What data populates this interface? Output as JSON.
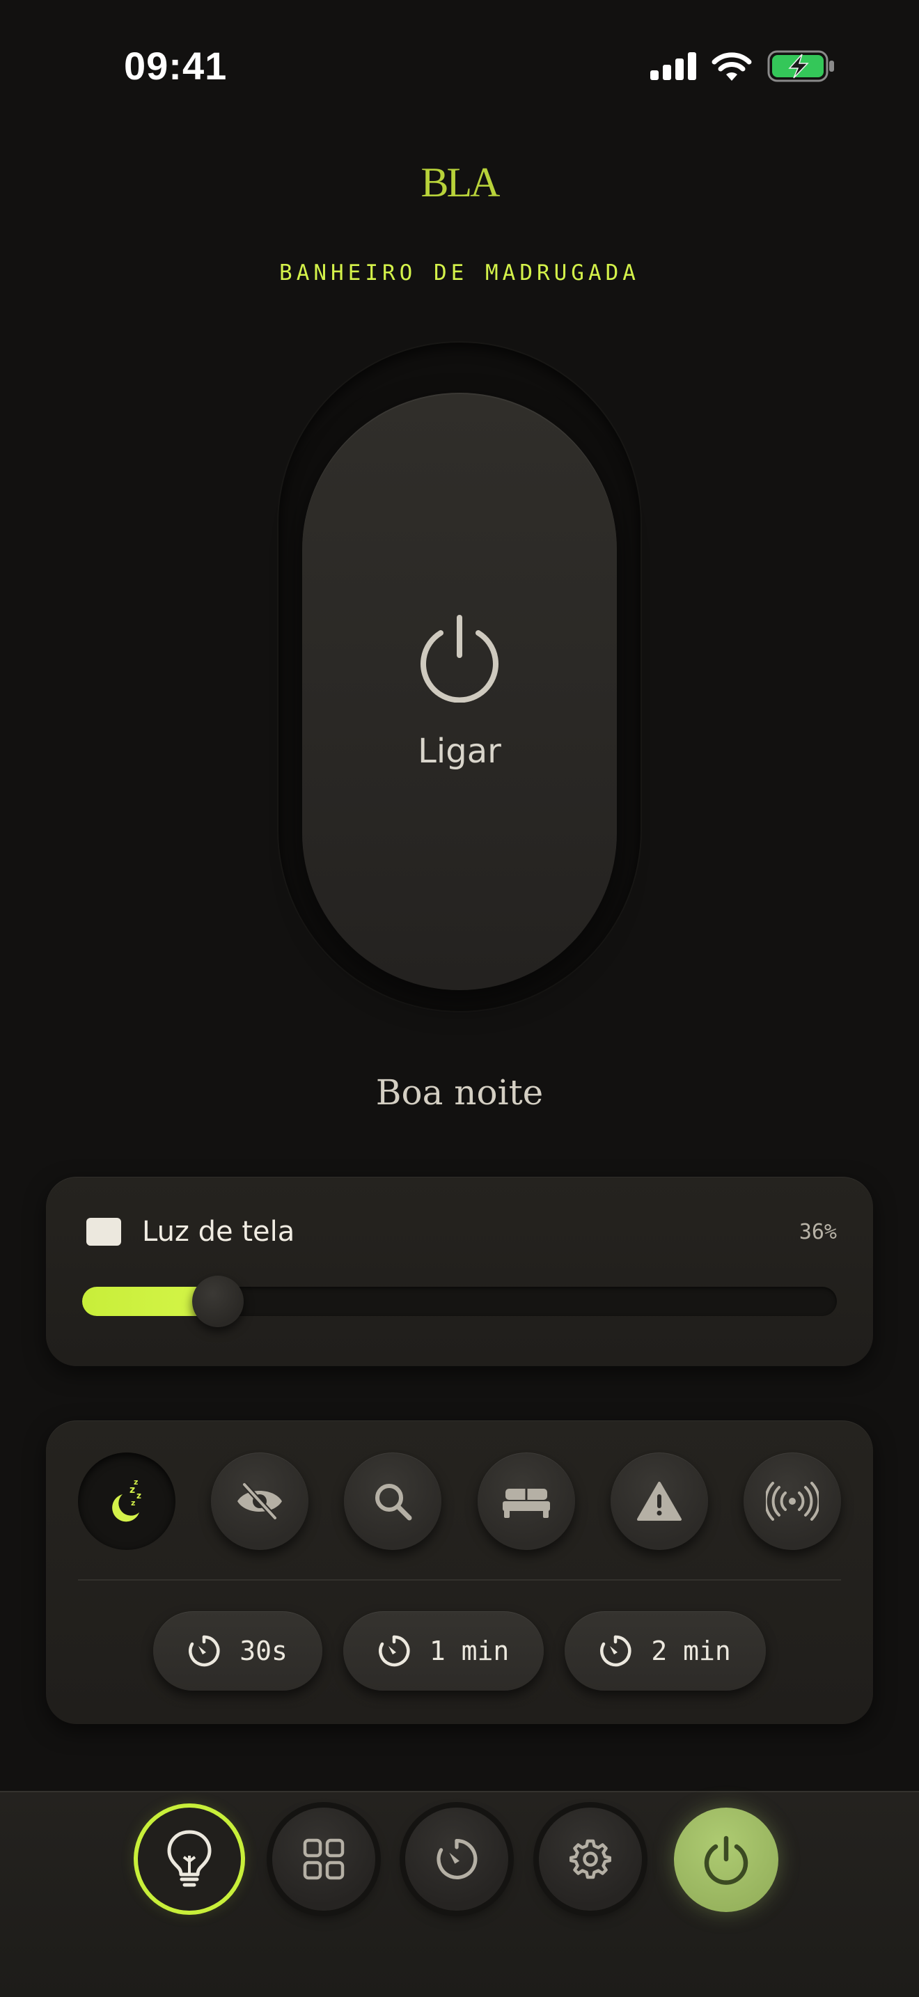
{
  "status_bar": {
    "time": "09:41",
    "icons": [
      "signal-icon",
      "wifi-icon",
      "battery-charging-icon"
    ]
  },
  "header": {
    "logo": "BLA",
    "location": "BANHEIRO DE MADRUGADA"
  },
  "main_toggle": {
    "label": "Ligar",
    "icon": "power-icon",
    "state": "off"
  },
  "greeting": "Boa noite",
  "screen_light": {
    "title": "Luz de tela",
    "percent_label": "36%",
    "level": 0.18,
    "swatch_color": "#ece8de"
  },
  "modes": [
    {
      "id": "sleep",
      "icon": "moon-sleep-icon",
      "active": true
    },
    {
      "id": "hidden",
      "icon": "eye-off-icon",
      "active": false
    },
    {
      "id": "search",
      "icon": "search-icon",
      "active": false
    },
    {
      "id": "bed",
      "icon": "bed-icon",
      "active": false
    },
    {
      "id": "alert",
      "icon": "warning-icon",
      "active": false
    },
    {
      "id": "broadcast",
      "icon": "broadcast-icon",
      "active": false
    }
  ],
  "timers": [
    {
      "label": "30s"
    },
    {
      "label": "1 min"
    },
    {
      "label": "2 min"
    }
  ],
  "nav": [
    {
      "id": "light",
      "icon": "lightbulb-icon",
      "selected": true
    },
    {
      "id": "scenes",
      "icon": "grid-icon",
      "selected": false
    },
    {
      "id": "timer",
      "icon": "timer-icon",
      "selected": false
    },
    {
      "id": "settings",
      "icon": "gear-icon",
      "selected": false
    },
    {
      "id": "power",
      "icon": "power-icon",
      "selected": false
    }
  ],
  "colors": {
    "accent": "#d4f24a",
    "background": "#121110",
    "card": "#23211e",
    "power_button": "#a3bf68",
    "battery": "#34c759"
  }
}
